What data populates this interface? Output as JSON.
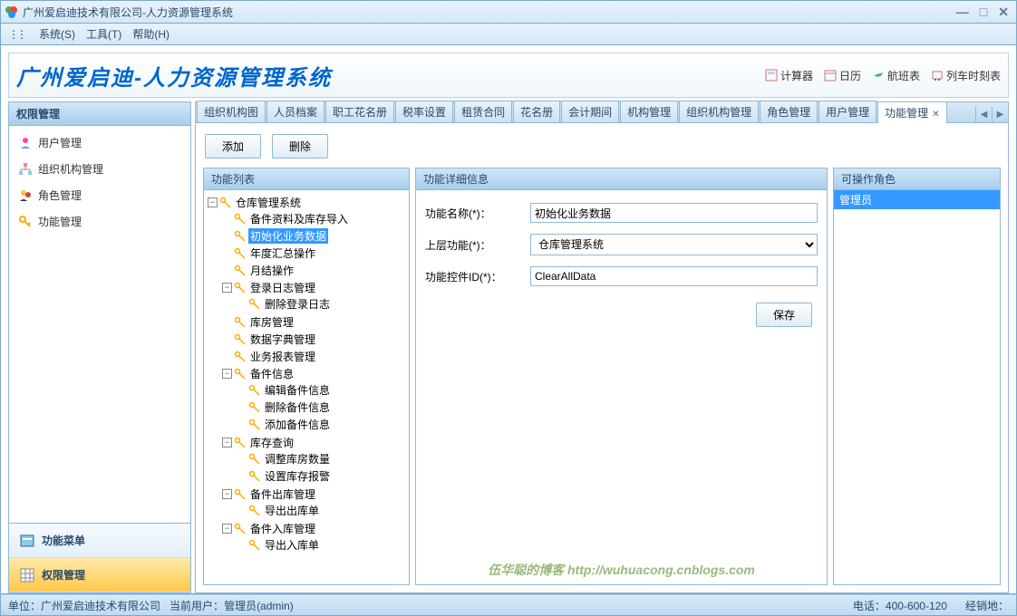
{
  "window": {
    "title": "广州爱启迪技术有限公司-人力资源管理系统"
  },
  "menubar": {
    "system": "系统(S)",
    "tools": "工具(T)",
    "help": "帮助(H)"
  },
  "banner": {
    "title": "广州爱启迪-人力资源管理系统",
    "tools": {
      "calculator": "计算器",
      "calendar": "日历",
      "flights": "航班表",
      "trains": "列车时刻表"
    }
  },
  "sidebar": {
    "header": "权限管理",
    "items": [
      {
        "label": "用户管理"
      },
      {
        "label": "组织机构管理"
      },
      {
        "label": "角色管理"
      },
      {
        "label": "功能管理"
      }
    ],
    "bottom": {
      "menu": "功能菜单",
      "perm": "权限管理"
    }
  },
  "tabs": [
    "组织机构图",
    "人员档案",
    "职工花名册",
    "税率设置",
    "租赁合同",
    "花名册",
    "会计期间",
    "机构管理",
    "组织机构管理",
    "角色管理",
    "用户管理",
    "功能管理"
  ],
  "toolbar": {
    "add": "添加",
    "delete": "删除"
  },
  "panel_titles": {
    "list": "功能列表",
    "detail": "功能详细信息",
    "roles": "可操作角色"
  },
  "tree": {
    "root": "仓库管理系统",
    "n0": "备件资料及库存导入",
    "n1": "初始化业务数据",
    "n2": "年度汇总操作",
    "n3": "月结操作",
    "g1": "登录日志管理",
    "g1_0": "删除登录日志",
    "n4": "库房管理",
    "n5": "数据字典管理",
    "n6": "业务报表管理",
    "g2": "备件信息",
    "g2_0": "编辑备件信息",
    "g2_1": "删除备件信息",
    "g2_2": "添加备件信息",
    "g3": "库存查询",
    "g3_0": "调整库房数量",
    "g3_1": "设置库存报警",
    "g4": "备件出库管理",
    "g4_0": "导出出库单",
    "g5": "备件入库管理",
    "g5_0": "导出入库单"
  },
  "form": {
    "name_label": "功能名称(*)：",
    "name_value": "初始化业务数据",
    "parent_label": "上层功能(*)：",
    "parent_value": "仓库管理系统",
    "control_label": "功能控件ID(*)：",
    "control_value": "ClearAllData",
    "save": "保存"
  },
  "roles": {
    "admin": "管理员"
  },
  "watermark": "伍华聪的博客 http://wuhuacong.cnblogs.com",
  "statusbar": {
    "company_label": "单位：",
    "company": "广州爱启迪技术有限公司",
    "user_label": "当前用户：",
    "user": "管理员(admin)",
    "phone_label": "电话：",
    "phone": "400-600-120",
    "sales_label": "经销地："
  }
}
